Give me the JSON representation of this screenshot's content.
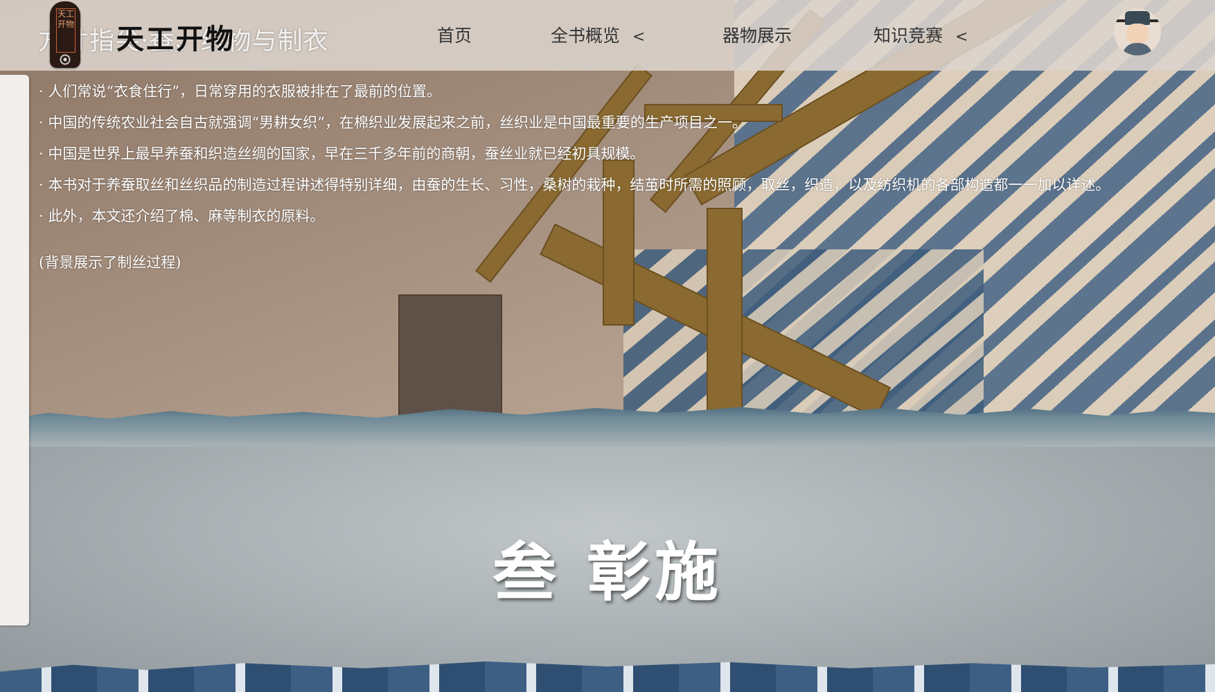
{
  "header": {
    "site_title": "方寸指尖·蚕、织物与制衣",
    "logo_seal_text": "天工开物",
    "logo_text": "天工开物",
    "nav": [
      {
        "label": "首页",
        "has_dropdown": false
      },
      {
        "label": "全书概览",
        "has_dropdown": true
      },
      {
        "label": "器物展示",
        "has_dropdown": false
      },
      {
        "label": "知识竞赛",
        "has_dropdown": true
      }
    ],
    "dropdown_glyph": "<",
    "avatar_icon": "official-portrait-avatar"
  },
  "intro": {
    "lines": [
      "· 人们常说“衣食住行”，日常穿用的衣服被排在了最前的位置。",
      "· 中国的传统农业社会自古就强调“男耕女织”，在棉织业发展起来之前，丝织业是中国最重要的生产项目之一。",
      "· 中国是世界上最早养蚕和织造丝绸的国家，早在三千多年前的商朝，蚕丝业就已经初具规模。",
      "· 本书对于养蚕取丝和丝织品的制造过程讲述得特别详细，由蚕的生长、习性，桑树的栽种，结茧时所需的照顾，取丝，织造，以及纺织机的各部构造都一一加以详述。",
      "· 此外，本文还介绍了棉、麻等制衣的原料。"
    ],
    "note": "(背景展示了制丝过程)"
  },
  "section": {
    "title": "叁 彰施"
  },
  "colors": {
    "navbar_bg": "#dcd4cd",
    "wood": "#8a6a30",
    "blanket_blue": "#4e6d8e"
  }
}
